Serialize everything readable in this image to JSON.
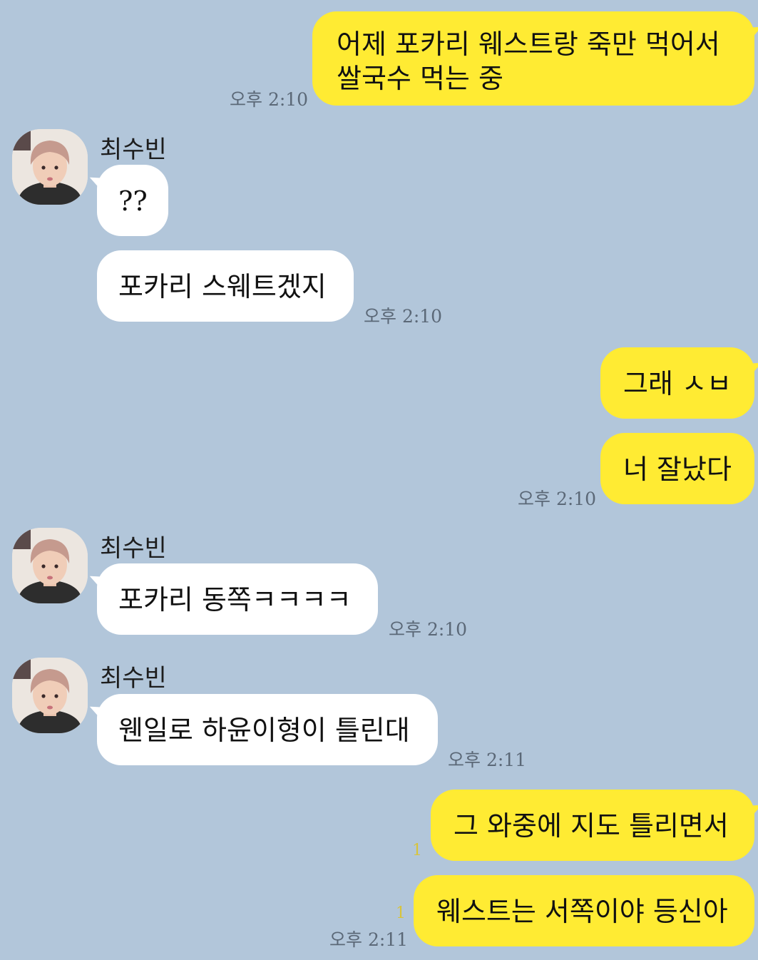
{
  "contact_name": "최수빈",
  "messages": [
    {
      "from": "me",
      "text_lines": [
        "어제 포카리 웨스트랑 죽만 먹어서",
        "쌀국수 먹는 중"
      ],
      "time": "오후 2:10"
    },
    {
      "from": "other",
      "text": "??"
    },
    {
      "from": "other",
      "text": "포카리 스웨트겠지",
      "time": "오후 2:10"
    },
    {
      "from": "me",
      "text": "그래 ㅅㅂ"
    },
    {
      "from": "me",
      "text": "너 잘났다",
      "time": "오후 2:10"
    },
    {
      "from": "other",
      "text": "포카리 동쪽ㅋㅋㅋㅋ",
      "time": "오후 2:10"
    },
    {
      "from": "other",
      "text": "웬일로 하윤이형이 틀린대",
      "time": "오후 2:11"
    },
    {
      "from": "me",
      "text": "그 와중에 지도 틀리면서",
      "unread": "1"
    },
    {
      "from": "me",
      "text": "웨스트는 서쪽이야 등신아",
      "unread": "1",
      "time": "오후 2:11"
    }
  ],
  "colors": {
    "background": "#b2c6da",
    "my_bubble": "#ffeb33",
    "their_bubble": "#ffffff",
    "unread_count": "#d8c43a"
  }
}
